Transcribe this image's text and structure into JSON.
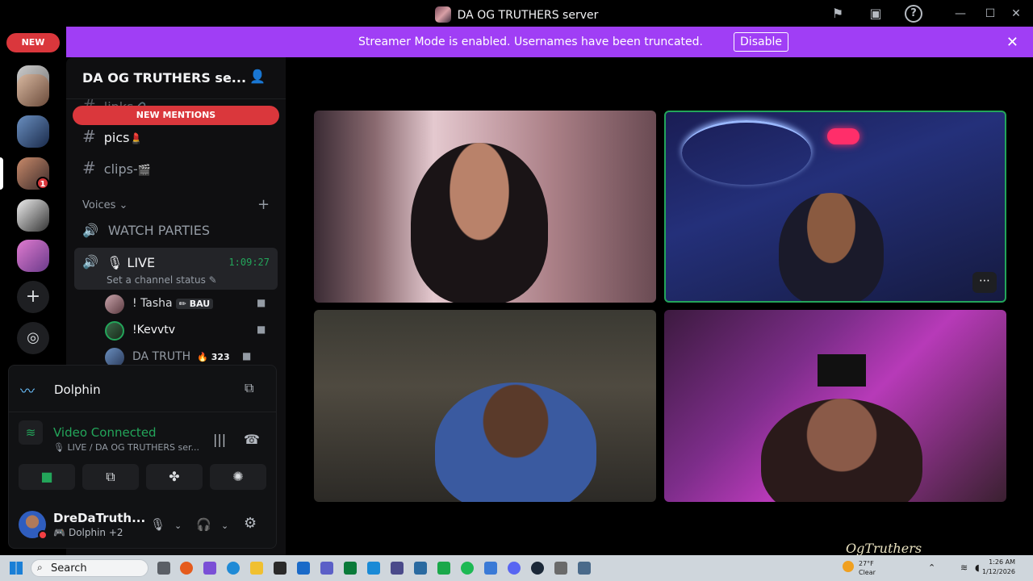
{
  "window": {
    "title": "DA OG TRUTHERS server"
  },
  "titlebar_icons": [
    "flag-icon",
    "inbox-icon",
    "help-icon"
  ],
  "window_controls": {
    "minimize": "—",
    "maximize": "☐",
    "close": "✕"
  },
  "banner": {
    "message": "Streamer Mode is enabled. Usernames have been truncated.",
    "button": "Disable",
    "close": "✕",
    "color": "#a03ef5"
  },
  "rail": {
    "new_pill": "NEW",
    "mention_count": "1",
    "add_server": "+",
    "discover": "◎"
  },
  "server": {
    "name": "DA OG TRUTHERS se...",
    "new_mentions": "NEW MENTIONS"
  },
  "channels": [
    {
      "hash": "#",
      "name": "links",
      "emoji": "🔗"
    },
    {
      "hash": "#",
      "name": "pics",
      "emoji": "💄"
    },
    {
      "hash": "#",
      "name": "clips-",
      "emoji": "🎬"
    }
  ],
  "voices": {
    "category": "Voices",
    "add": "+",
    "watch_parties": "WATCH PARTIES",
    "live": {
      "name": "LIVE",
      "timer": "1:09:27",
      "status": "Set a channel status"
    },
    "users": [
      {
        "name": "! Tasha",
        "tag": "BAU",
        "tag_icon": "✏"
      },
      {
        "name": "!Kevvtv",
        "tag": "",
        "tag_icon": ""
      },
      {
        "name": "DA TRUTH",
        "tag": "323",
        "tag_icon": "🔥"
      }
    ]
  },
  "panel": {
    "activity_name": "Dolphin",
    "connection_title": "Video Connected",
    "connection_sub": "LIVE / DA OG TRUTHERS ser...",
    "user_name": "DreDaTruth...",
    "user_activity": "Dolphin",
    "user_activity_extra": "+2"
  },
  "taskbar": {
    "search": "Search",
    "weather_temp": "27°F",
    "weather_desc": "Clear",
    "time": "1:26 AM",
    "date": "1/12/2026"
  },
  "watermark": "OgTruthers",
  "colors": {
    "accent_green": "#23a55a",
    "danger_red": "#da373c",
    "brand_purple": "#a03ef5"
  }
}
